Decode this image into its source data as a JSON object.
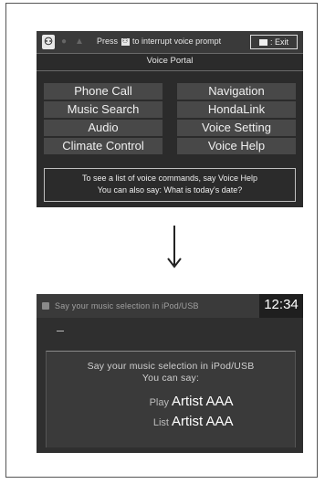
{
  "portal_screen": {
    "prompt_prefix": "Press",
    "prompt_suffix": "to interrupt voice prompt",
    "exit_label": ": Exit",
    "title": "Voice Portal",
    "commands": [
      "Phone Call",
      "Navigation",
      "Music Search",
      "HondaLink",
      "Audio",
      "Voice Setting",
      "Climate Control",
      "Voice Help"
    ],
    "help_line1": "To see a list of voice commands, say Voice Help",
    "help_line2": "You can also say: What is today's date?"
  },
  "music_screen": {
    "top_text": "Say your music selection in iPod/USB",
    "clock": "12:34",
    "line1": "Say your music selection in iPod/USB",
    "line2": "You can say:",
    "options": [
      {
        "verb": "Play",
        "arg": "Artist AAA"
      },
      {
        "verb": "List",
        "arg": "Artist AAA"
      }
    ]
  },
  "icons": {
    "talk": "talk-button-icon",
    "arrow": "down-arrow-icon"
  }
}
